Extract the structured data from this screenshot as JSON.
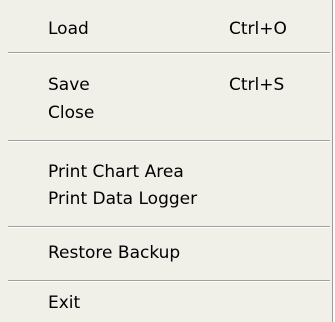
{
  "menu": {
    "items": [
      {
        "label": "Load",
        "shortcut": "Ctrl+O"
      },
      {
        "label": "Save",
        "shortcut": "Ctrl+S"
      },
      {
        "label": "Close",
        "shortcut": ""
      },
      {
        "label": "Print Chart Area",
        "shortcut": ""
      },
      {
        "label": "Print Data Logger",
        "shortcut": ""
      },
      {
        "label": "Restore Backup",
        "shortcut": ""
      },
      {
        "label": "Exit",
        "shortcut": ""
      }
    ]
  },
  "colors": {
    "menu_background": "#f0efe8",
    "separator_dark": "#a0a0a0",
    "text": "#000000"
  }
}
